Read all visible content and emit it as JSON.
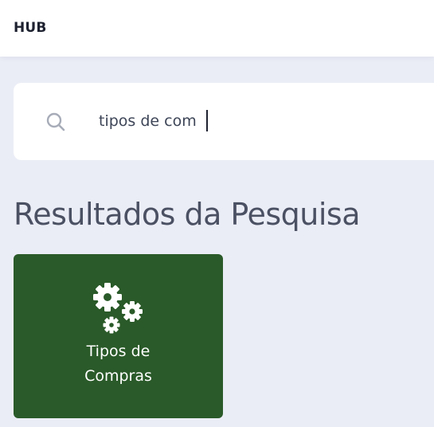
{
  "header": {
    "brand": "HUB"
  },
  "search": {
    "value": "tipos de com",
    "icon": "search-icon"
  },
  "results": {
    "title": "Resultados da Pesquisa",
    "items": [
      {
        "label_line1": "Tipos de",
        "label_line2": "Compras",
        "icon": "gears-icon",
        "color": "#2a5a29"
      }
    ]
  },
  "colors": {
    "background": "#ebedf6",
    "card_green": "#2a5a29",
    "text_dark": "#1e2230",
    "title_gray": "#4b5163"
  }
}
